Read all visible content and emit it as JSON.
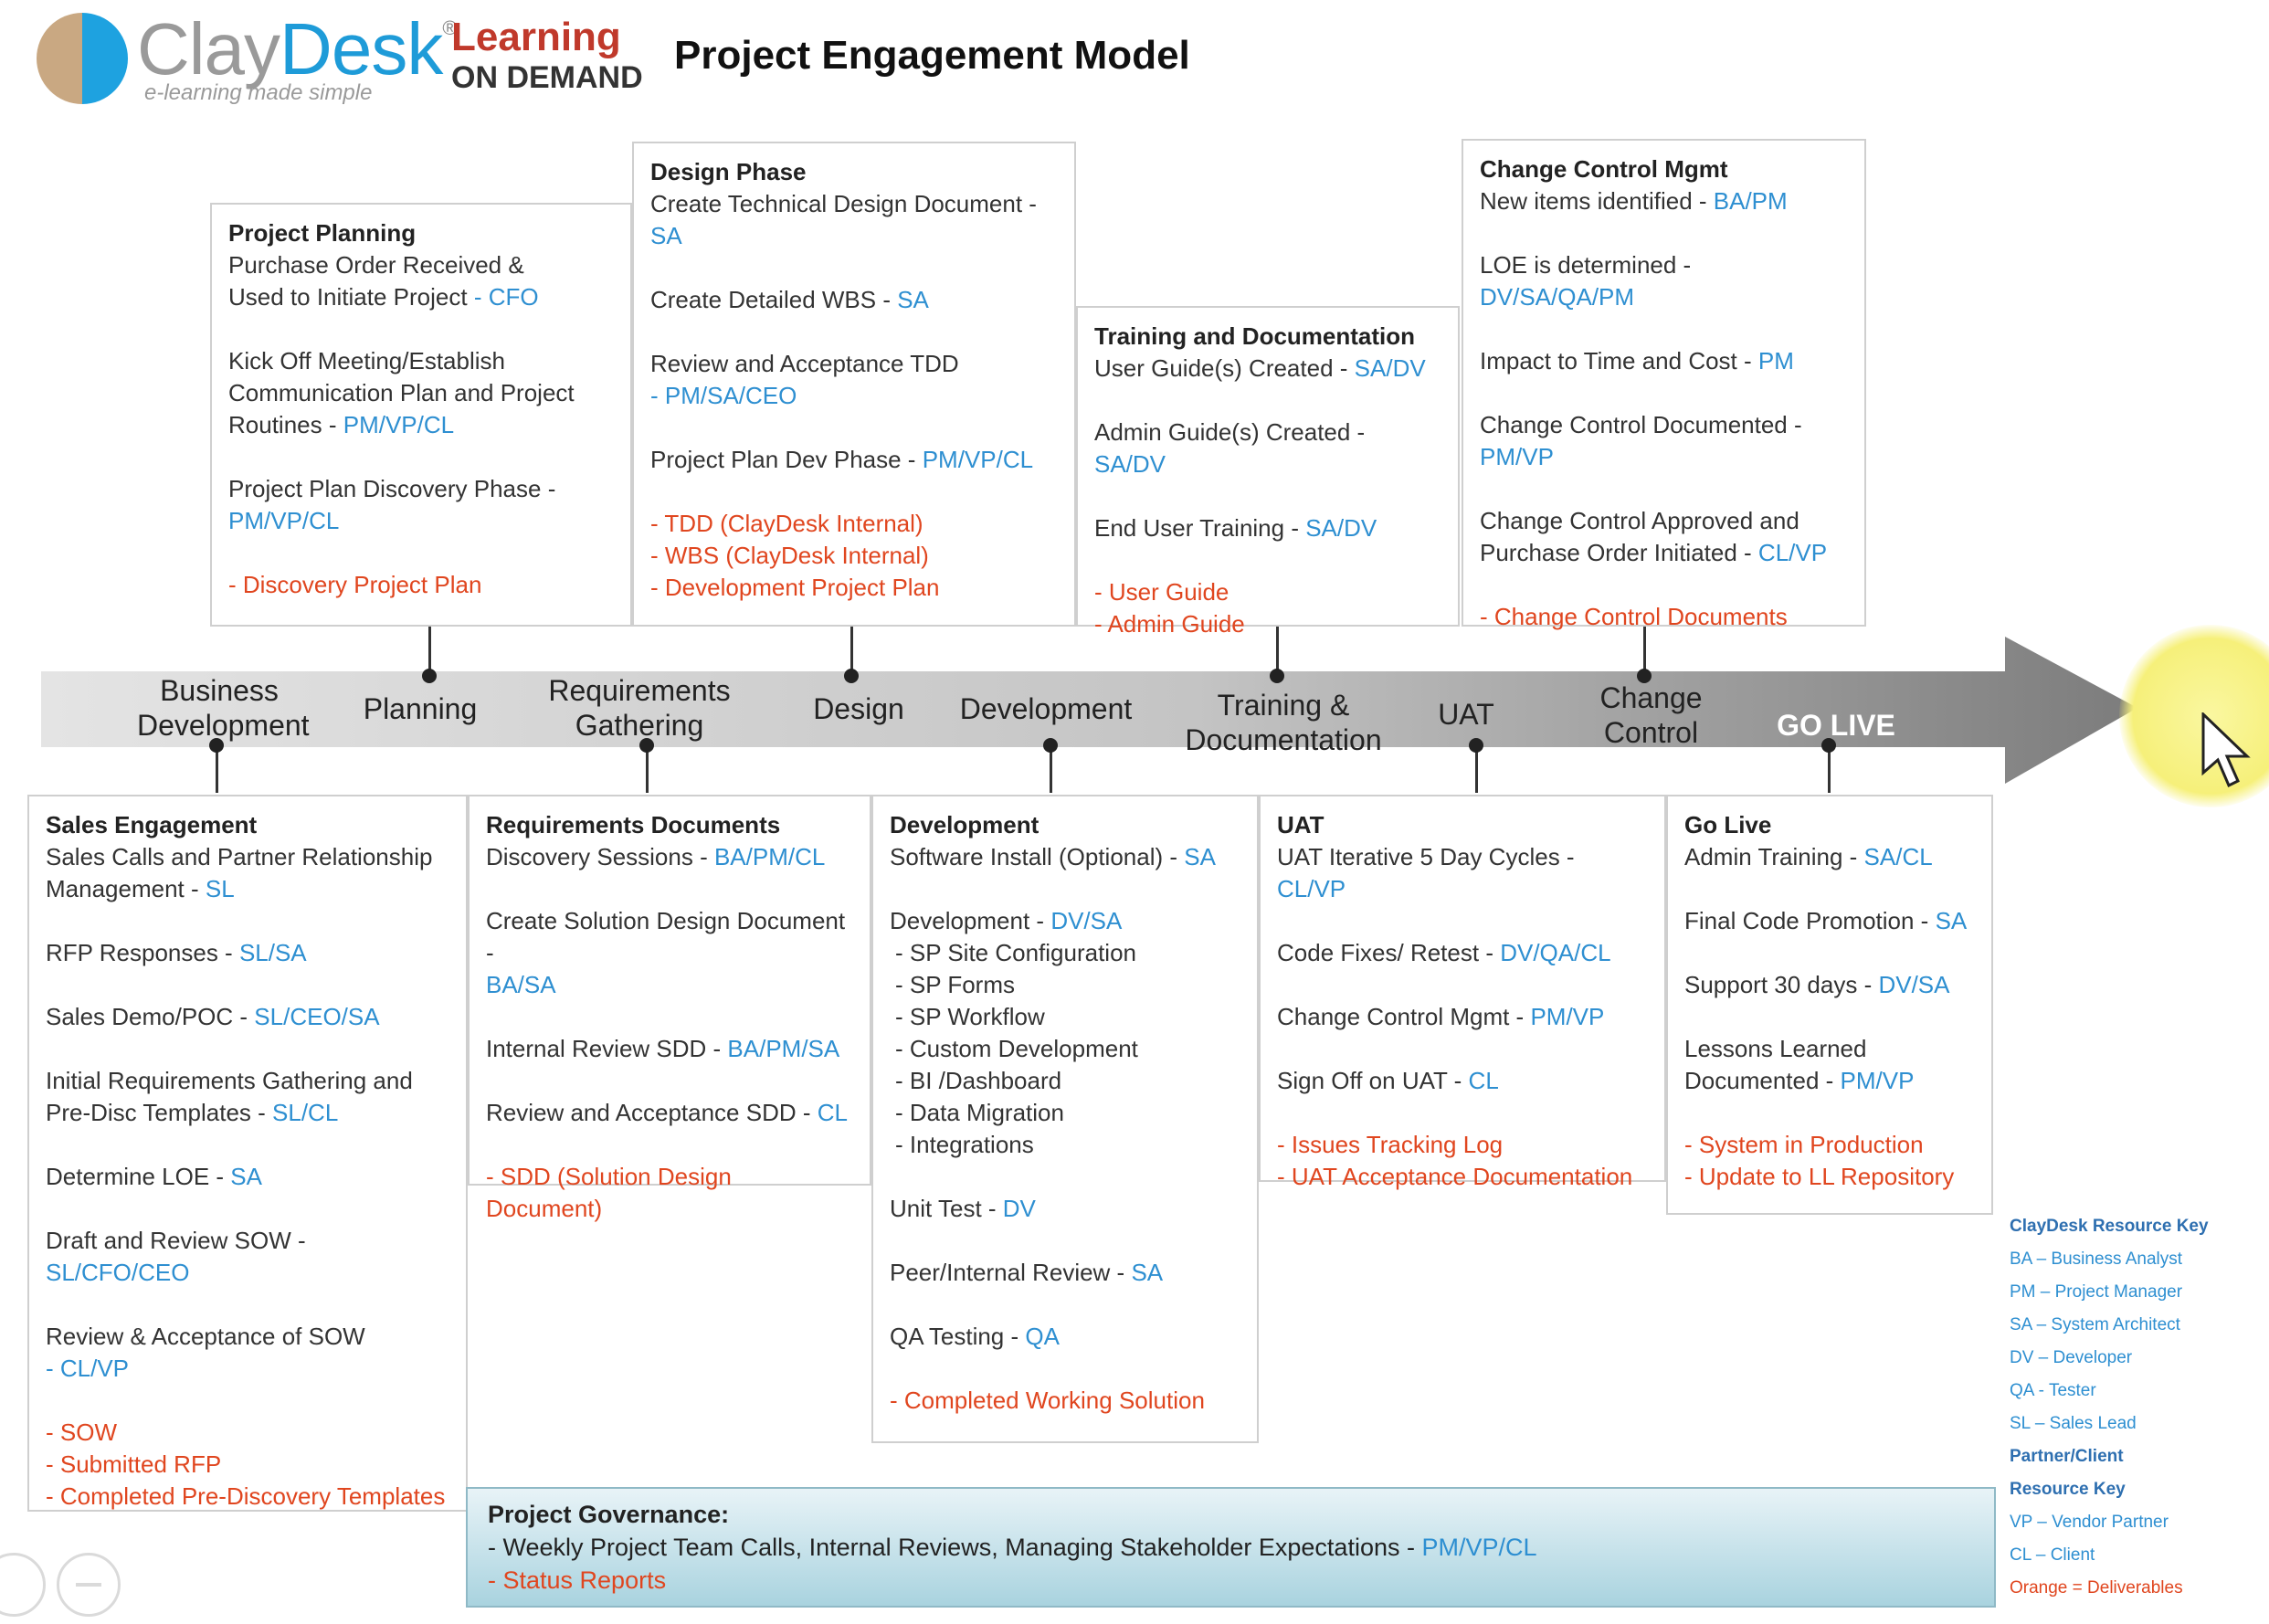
{
  "header": {
    "logo_clay": "Clay",
    "logo_desk": "Desk",
    "logo_reg": "®",
    "logo_tagline": "e-learning made simple",
    "lod_line1": "Learning",
    "lod_line2": "ON DEMAND",
    "title": "Project Engagement Model"
  },
  "phases": [
    {
      "label": "Business\nDevelopment"
    },
    {
      "label": "Planning"
    },
    {
      "label": "Requirements\nGathering"
    },
    {
      "label": "Design"
    },
    {
      "label": "Development"
    },
    {
      "label": "Training &\nDocumentation"
    },
    {
      "label": "UAT"
    },
    {
      "label": "Change\nControl"
    },
    {
      "label": "GO LIVE"
    }
  ],
  "top_boxes": [
    {
      "title": "Project Planning",
      "items": [
        {
          "text": "Purchase Order Received &\nUsed to Initiate Project ",
          "role": "- CFO"
        },
        {
          "text": "Kick Off Meeting/Establish\nCommunication Plan and Project\nRoutines - ",
          "role": "PM/VP/CL"
        },
        {
          "text": "Project Plan Discovery Phase -\n",
          "role": "PM/VP/CL"
        }
      ],
      "deliverables": [
        "- Discovery Project Plan"
      ]
    },
    {
      "title": "Design Phase",
      "items": [
        {
          "text": "Create Technical Design Document -\n",
          "role": "SA"
        },
        {
          "text": "Create Detailed WBS - ",
          "role": "SA"
        },
        {
          "text": "Review and Acceptance TDD\n",
          "role": " - PM/SA/CEO"
        },
        {
          "text": "Project Plan Dev Phase - ",
          "role": "PM/VP/CL"
        }
      ],
      "deliverables": [
        "- TDD (ClayDesk Internal)",
        "- WBS (ClayDesk Internal)",
        "- Development Project Plan"
      ]
    },
    {
      "title": "Training and Documentation",
      "items": [
        {
          "text": "User Guide(s) Created - ",
          "role": "SA/DV"
        },
        {
          "text": "Admin Guide(s) Created - ",
          "role": "SA/DV"
        },
        {
          "text": "End User Training - ",
          "role": "SA/DV"
        }
      ],
      "deliverables": [
        "- User Guide",
        "- Admin Guide"
      ]
    },
    {
      "title": "Change Control Mgmt",
      "items": [
        {
          "text": "New items identified - ",
          "role": "BA/PM"
        },
        {
          "text": "LOE is determined - ",
          "role": "DV/SA/QA/PM"
        },
        {
          "text": "Impact to Time and Cost - ",
          "role": "PM"
        },
        {
          "text": "Change Control Documented -\n",
          "role": "PM/VP"
        },
        {
          "text": "Change Control Approved and\nPurchase Order Initiated - ",
          "role": "CL/VP"
        }
      ],
      "deliverables": [
        "- Change Control Documents"
      ]
    }
  ],
  "bottom_boxes": [
    {
      "title": "Sales Engagement",
      "items": [
        {
          "text": "Sales Calls and Partner Relationship\nManagement  - ",
          "role": "SL"
        },
        {
          "text": "RFP Responses - ",
          "role": "SL/SA"
        },
        {
          "text": "Sales Demo/POC - ",
          "role": "SL/CEO/SA"
        },
        {
          "text": "Initial Requirements Gathering and\nPre-Disc Templates - ",
          "role": "SL/CL"
        },
        {
          "text": "Determine LOE - ",
          "role": "SA"
        },
        {
          "text": "Draft and Review SOW - ",
          "role": "SL/CFO/CEO"
        },
        {
          "text": "Review & Acceptance of SOW\n",
          "role": " - CL/VP"
        }
      ],
      "deliverables": [
        "- SOW",
        "- Submitted RFP",
        "- Completed Pre-Discovery Templates"
      ]
    },
    {
      "title": "Requirements Documents",
      "items": [
        {
          "text": "Discovery Sessions - ",
          "role": "BA/PM/CL"
        },
        {
          "text": "Create Solution Design Document -\n",
          "role": "BA/SA"
        },
        {
          "text": "Internal Review SDD - ",
          "role": "BA/PM/SA"
        },
        {
          "text": "Review and Acceptance SDD - ",
          "role": "CL"
        }
      ],
      "deliverables": [
        "- SDD (Solution Design Document)"
      ]
    },
    {
      "title": "Development",
      "items": [
        {
          "text": "Software Install (Optional) - ",
          "role": "SA"
        },
        {
          "text": "Development - ",
          "role": "DV/SA",
          "sub": [
            "- SP Site Configuration",
            "- SP Forms",
            "- SP Workflow",
            "- Custom Development",
            "- BI /Dashboard",
            "- Data Migration",
            "- Integrations"
          ]
        },
        {
          "text": "Unit Test - ",
          "role": "DV"
        },
        {
          "text": "Peer/Internal Review - ",
          "role": "SA"
        },
        {
          "text": "QA Testing - ",
          "role": "QA"
        }
      ],
      "deliverables": [
        "- Completed Working Solution"
      ]
    },
    {
      "title": "UAT",
      "items": [
        {
          "text": "UAT Iterative 5 Day Cycles - ",
          "role": "CL/VP"
        },
        {
          "text": "Code Fixes/ Retest  - ",
          "role": "DV/QA/CL"
        },
        {
          "text": "Change Control Mgmt - ",
          "role": "PM/VP"
        },
        {
          "text": "Sign Off on UAT - ",
          "role": "CL"
        }
      ],
      "deliverables": [
        "- Issues Tracking Log",
        "- UAT Acceptance Documentation"
      ]
    },
    {
      "title": "Go Live",
      "items": [
        {
          "text": "Admin Training - ",
          "role": "SA/CL"
        },
        {
          "text": "Final Code Promotion - ",
          "role": "SA"
        },
        {
          "text": "Support 30 days - ",
          "role": "DV/SA"
        },
        {
          "text": "Lessons Learned\nDocumented - ",
          "role": "PM/VP"
        }
      ],
      "deliverables": [
        "- System in Production",
        "- Update to LL Repository"
      ]
    }
  ],
  "governance": {
    "title": "Project Governance:",
    "line": "- Weekly Project Team Calls, Internal Reviews, Managing Stakeholder Expectations - ",
    "role": "PM/VP/CL",
    "deliverable": "- Status Reports"
  },
  "resource_key": {
    "claydesk_title": "ClayDesk Resource Key",
    "claydesk_items": [
      "BA – Business Analyst",
      "PM – Project Manager",
      "SA – System Architect",
      "DV – Developer",
      "QA - Tester",
      "SL – Sales Lead"
    ],
    "partner_title_1": "Partner/Client",
    "partner_title_2": "Resource Key",
    "partner_items": [
      "VP – Vendor Partner",
      "CL – Client"
    ],
    "orange_note": "Orange = Deliverables"
  },
  "colors": {
    "role": "#2e8fd1",
    "deliverable": "#e0461f",
    "arrow_light": "#d9d9d9",
    "arrow_dark": "#8a8a8a"
  },
  "icons": [
    "cursor-arrow-icon",
    "zoom-icon",
    "minus-circle-icon"
  ]
}
